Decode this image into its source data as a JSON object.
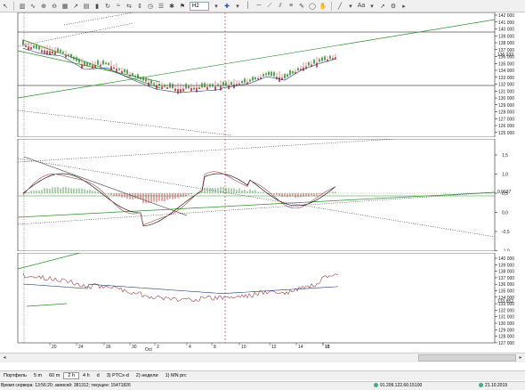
{
  "toolbar": {
    "timeframe": "H2",
    "icons": [
      "arrow-cursor-icon",
      "chart-bars-icon",
      "chart-line-icon",
      "zoom-in-icon",
      "zoom-out-icon",
      "timeframe-select",
      "plus-crosshair-icon",
      "chevron-down-icon",
      "vertical-line-icon",
      "horizontal-line-icon",
      "ray-icon",
      "channel-icon",
      "pencil-icon",
      "fibonacci-icon",
      "ellipse-icon",
      "hand-icon",
      "cursor-icon",
      "trendline-icon",
      "text-icon",
      "arrow-icon",
      "star-icon",
      "color-icon",
      "settings-icon",
      "lock-icon",
      "play-icon"
    ]
  },
  "price_panel": {
    "y_ticks": [
      "142 000",
      "141 000",
      "140 000",
      "139 000",
      "138 000",
      "137 000",
      "136 000",
      "135 000",
      "134 000",
      "133 000",
      "132 000",
      "131 000",
      "130 000",
      "129 000",
      "128 000",
      "127 000",
      "126 000",
      "125 000"
    ],
    "current_value": "136 233"
  },
  "oscillator_panel": {
    "y_ticks": [
      "1,5",
      "1,0",
      "0,5",
      "0,0",
      "-0,5",
      "-1,0"
    ],
    "current_value": "0,0637"
  },
  "lower_panel": {
    "y_ticks": [
      "140 000",
      "139 000",
      "138 000",
      "137 000",
      "136 000",
      "135 000",
      "134 000",
      "133 000",
      "132 000",
      "131 000",
      "130 000",
      "129 000",
      "128 000",
      "127 000"
    ],
    "current_value": "133 852"
  },
  "x_axis": {
    "day_labels": [
      "20",
      "24",
      "26",
      "30",
      "2",
      "4",
      "8",
      "10",
      "12",
      "14",
      "16",
      "18"
    ],
    "month_label": "Oct"
  },
  "tabs": {
    "items": [
      "Портфель",
      "5 m",
      "60 m",
      "2 h",
      "4 h",
      "d",
      "3) PTCx-d",
      "2) недели",
      "1) MN prc"
    ]
  },
  "status": {
    "left": "Время сервера: 13:56:20; записей: 381312; текущее: 15471826",
    "middle": "91.209.122.66:15100",
    "right": "21.10.2019"
  },
  "colors": {
    "candle_up": "#3c8a3c",
    "candle_down": "#b03030",
    "price_line": "#a04040",
    "ma_line": "#283c78",
    "green_line": "#2f8f2f",
    "cursor_line": "#c03030"
  }
}
